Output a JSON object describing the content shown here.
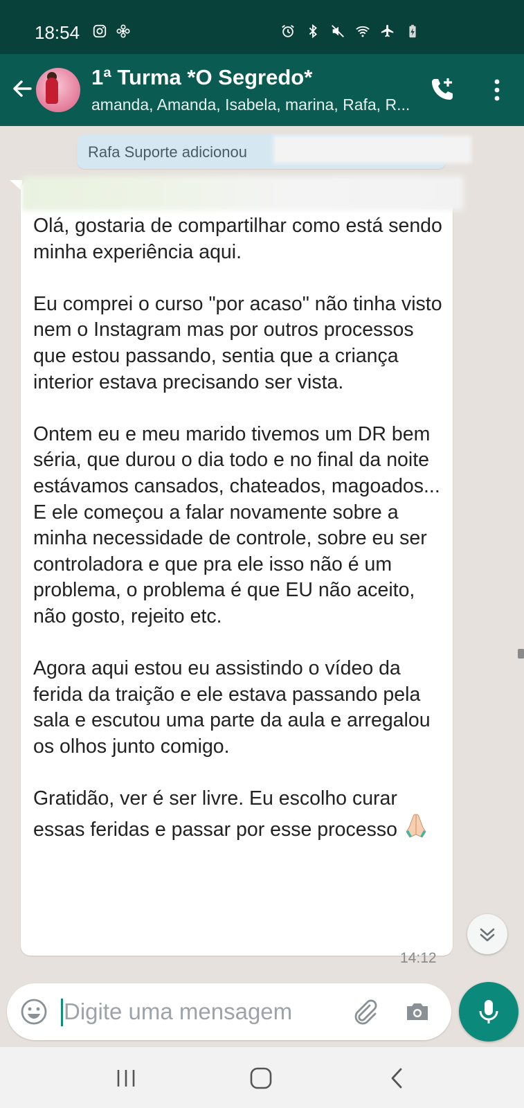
{
  "status_bar": {
    "time": "18:54"
  },
  "header": {
    "title": "1ª Turma *O Segredo*",
    "subtitle": "amanda, Amanda, Isabela, marina, Rafa, R..."
  },
  "system_message": {
    "text": "Rafa Suporte adicionou"
  },
  "message": {
    "paragraphs": [
      "Olá, gostaria de compartilhar como está sendo minha experiência aqui.",
      "Eu comprei o curso \"por acaso\" não tinha visto nem o Instagram mas por outros processos que  estou passando, sentia que a criança interior estava precisando ser vista.",
      "Ontem eu e meu marido tivemos um DR bem séria, que durou o dia todo e no final da noite estávamos cansados, chateados, magoados... E ele começou a falar novamente sobre a minha necessidade de controle, sobre eu ser controladora e que pra ele isso não é um problema, o problema é que EU não aceito, não gosto, rejeito etc.",
      "Agora aqui estou eu assistindo o vídeo da ferida da traição e ele estava passando pela sala e escutou uma parte da aula e arregalou os olhos junto comigo.",
      "Gratidão, ver é ser livre. Eu escolho curar essas feridas e passar por esse processo"
    ],
    "emoji": "🙏",
    "time": "14:12"
  },
  "composer": {
    "placeholder": "Digite uma mensagem"
  },
  "icons": {
    "back": "arrow-left-icon",
    "call": "add-call-icon",
    "menu": "more-vertical-icon",
    "emoji": "smiley-icon",
    "attach": "paperclip-icon",
    "camera": "camera-icon",
    "mic": "microphone-icon",
    "scroll": "double-chevron-down-icon"
  },
  "colors": {
    "header": "#0a5b51",
    "status_bar": "#08403a",
    "accent": "#0b8a7c",
    "system_bubble": "#d5e8f1"
  }
}
